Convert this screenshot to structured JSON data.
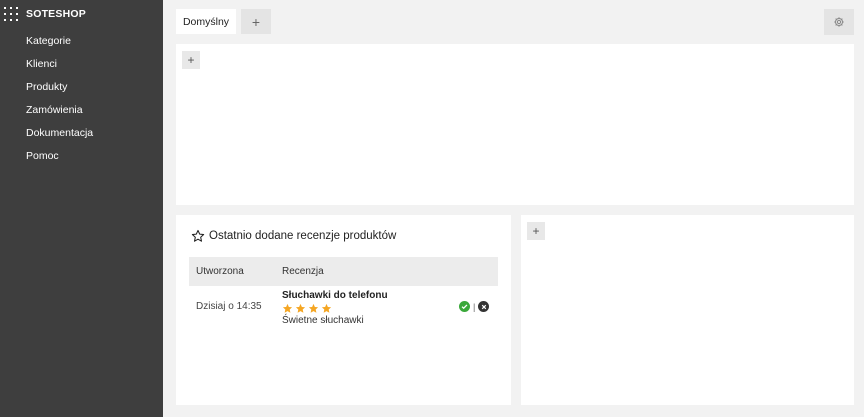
{
  "sidebar": {
    "brand": "SOTESHOP",
    "items": [
      {
        "label": "Kategorie"
      },
      {
        "label": "Klienci"
      },
      {
        "label": "Produkty"
      },
      {
        "label": "Zamówienia"
      },
      {
        "label": "Dokumentacja"
      },
      {
        "label": "Pomoc"
      }
    ]
  },
  "tabs": {
    "active_label": "Domyślny",
    "add_label": "+",
    "settings_icon": "gear-icon"
  },
  "panels": {
    "add_label": "+"
  },
  "reviews_widget": {
    "title": "Ostatnio dodane recenzje produktów",
    "columns": [
      "Utworzona",
      "Recenzja"
    ],
    "rows": [
      {
        "created": "Dzisiaj o 14:35",
        "product": "Słuchawki do telefonu",
        "rating": 4,
        "rating_max": 4,
        "text": "Świetne słuchawki",
        "separator": "|"
      }
    ]
  },
  "colors": {
    "sidebar_bg": "#3e3e3e",
    "star": "#f5a623",
    "approve": "#3aa83a",
    "reject": "#333333"
  }
}
